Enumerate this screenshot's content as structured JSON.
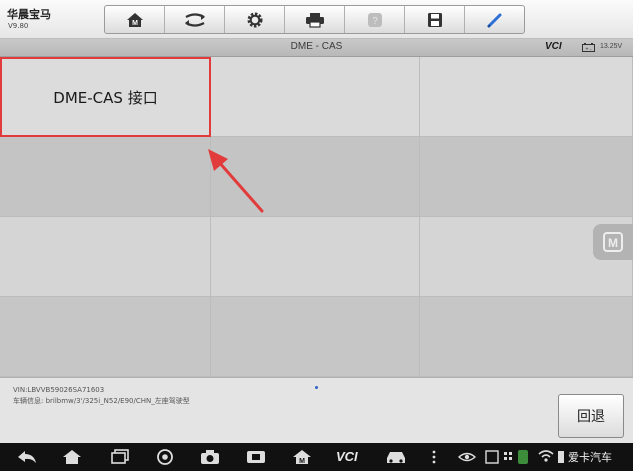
{
  "header": {
    "app_name": "华晨宝马",
    "version": "V9.80",
    "toolbar": [
      {
        "icon": "home-icon"
      },
      {
        "icon": "swap-icon"
      },
      {
        "icon": "gear-icon"
      },
      {
        "icon": "print-icon"
      },
      {
        "icon": "help-icon"
      },
      {
        "icon": "save-icon"
      },
      {
        "icon": "pen-icon"
      }
    ]
  },
  "titlebar": {
    "title": "DME - CAS",
    "vci_logo": "VCI",
    "voltage": "13.25V"
  },
  "grid": {
    "cells": [
      "DME-CAS 接口",
      "",
      "",
      "",
      "",
      "",
      "",
      "",
      "",
      "",
      "",
      ""
    ],
    "highlight_color": "#e23b3b"
  },
  "info": {
    "vin": "VIN:LBVVB59026SA71603",
    "vehicle": "车辆信息: brilbmw/3'/325i_N52/E90/CHN_左座驾驶型",
    "back_label": "回退"
  },
  "navbar": {
    "icons": [
      "back-icon",
      "home-icon",
      "recents-icon",
      "browser-icon",
      "camera-icon",
      "screenshot-icon",
      "maxisys-icon",
      "vci-icon",
      "car-icon",
      "dots-icon",
      "eye-icon",
      "wifi-icon",
      "battery-icon"
    ],
    "vci_label": "VCI"
  },
  "watermark": "爱卡汽车"
}
